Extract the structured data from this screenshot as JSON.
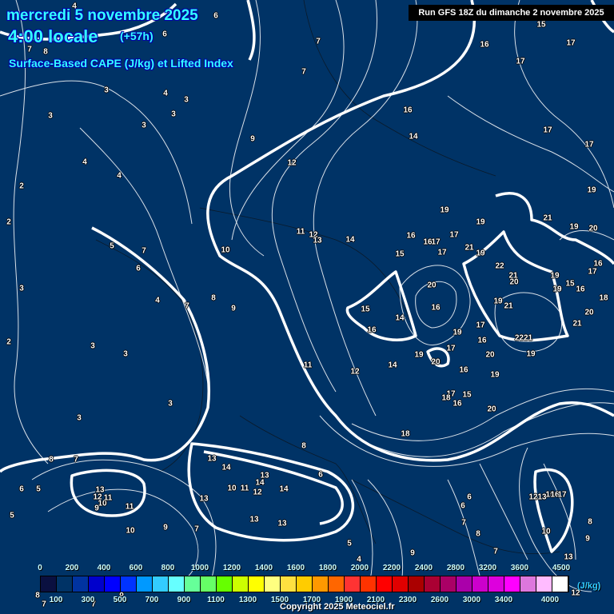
{
  "header": {
    "date": "mercredi 5 novembre 2025",
    "time": "4:00 locale",
    "lead": "(+57h)",
    "parameter": "Surface-Based CAPE (J/kg) et Lifted Index",
    "run": "Run GFS 18Z du dimanche 2 novembre 2025"
  },
  "legend": {
    "colors": [
      "#0a1040",
      "#003366",
      "#0033a0",
      "#0000cc",
      "#0000ff",
      "#0033ff",
      "#0099ff",
      "#33ccff",
      "#66ffff",
      "#66ff99",
      "#66ff66",
      "#66ff00",
      "#ccff00",
      "#ffff00",
      "#ffff80",
      "#ffe040",
      "#ffcc00",
      "#ff9900",
      "#ff6600",
      "#ff3333",
      "#ff3300",
      "#ff0000",
      "#e00000",
      "#aa0000",
      "#aa0033",
      "#aa0066",
      "#aa00aa",
      "#cc00cc",
      "#dd00dd",
      "#ff00ff",
      "#dd77dd",
      "#ffbbff",
      "#ffffff"
    ],
    "top_labels": [
      "0",
      "200",
      "400",
      "600",
      "800",
      "1000",
      "1200",
      "1400",
      "1600",
      "1800",
      "2000",
      "2200",
      "2400",
      "2800",
      "3200",
      "3600",
      "4500"
    ],
    "bottom_labels": [
      "100",
      "300",
      "500",
      "700",
      "900",
      "1100",
      "1300",
      "1500",
      "1700",
      "1900",
      "2100",
      "2300",
      "2600",
      "3000",
      "3400",
      "4000"
    ],
    "unit": "(J/kg)"
  },
  "copyright": "Copyright 2025 Meteociel.fr",
  "lifted_index_labels": [
    "4",
    "6",
    "6",
    "7",
    "8",
    "7",
    "7",
    "3",
    "4",
    "3",
    "3",
    "3",
    "3",
    "9",
    "4",
    "4",
    "2",
    "12",
    "2",
    "5",
    "7",
    "6",
    "10",
    "11",
    "12",
    "13",
    "14",
    "3",
    "4",
    "7",
    "8",
    "9",
    "2",
    "3",
    "3",
    "11",
    "12",
    "3",
    "3",
    "8",
    "7",
    "8",
    "13",
    "14",
    "13",
    "14",
    "14",
    "6",
    "10",
    "11",
    "12",
    "13",
    "12",
    "10",
    "11",
    "9",
    "11",
    "13",
    "13",
    "13",
    "10",
    "9",
    "7",
    "6",
    "5",
    "5",
    "5",
    "4",
    "9",
    "7",
    "8",
    "7",
    "6",
    "6",
    "15",
    "16",
    "17",
    "17",
    "16",
    "14",
    "17",
    "17",
    "19",
    "21",
    "19",
    "20",
    "19",
    "19",
    "16",
    "16",
    "17",
    "17",
    "17",
    "21",
    "19",
    "22",
    "15",
    "20",
    "21",
    "20",
    "19",
    "15",
    "19",
    "16",
    "16",
    "17",
    "15",
    "16",
    "19",
    "21",
    "14",
    "16",
    "17",
    "19",
    "18",
    "20",
    "21",
    "2221",
    "19",
    "20",
    "17",
    "16",
    "20",
    "19",
    "14",
    "16",
    "19",
    "17",
    "18",
    "15",
    "16",
    "20",
    "18",
    "12",
    "13",
    "15",
    "16",
    "17",
    "10",
    "8",
    "9",
    "13",
    "12",
    "8",
    "7",
    "7",
    "8"
  ]
}
